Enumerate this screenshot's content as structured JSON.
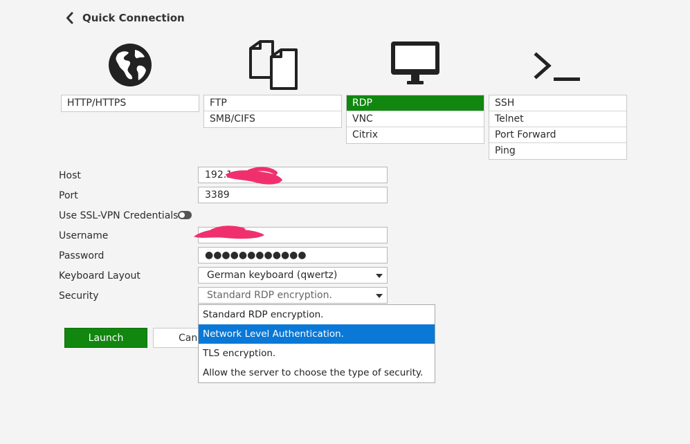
{
  "header": {
    "back_title": "Quick Connection"
  },
  "protocols": [
    {
      "icon": "globe-icon",
      "options": [
        {
          "label": "HTTP/HTTPS",
          "active": false
        }
      ]
    },
    {
      "icon": "copy-files-icon",
      "options": [
        {
          "label": "FTP",
          "active": false
        },
        {
          "label": "SMB/CIFS",
          "active": false
        }
      ]
    },
    {
      "icon": "monitor-icon",
      "options": [
        {
          "label": "RDP",
          "active": true
        },
        {
          "label": "VNC",
          "active": false
        },
        {
          "label": "Citrix",
          "active": false
        }
      ]
    },
    {
      "icon": "terminal-icon",
      "options": [
        {
          "label": "SSH",
          "active": false
        },
        {
          "label": "Telnet",
          "active": false
        },
        {
          "label": "Port Forward",
          "active": false
        },
        {
          "label": "Ping",
          "active": false
        }
      ]
    }
  ],
  "form": {
    "host_label": "Host",
    "host_value": "192.1",
    "port_label": "Port",
    "port_value": "3389",
    "ssl_label": "Use SSL-VPN Credentials",
    "ssl_enabled": false,
    "username_label": "Username",
    "username_value": "",
    "password_label": "Password",
    "password_value": "●●●●●●●●●●●●",
    "keyboard_label": "Keyboard Layout",
    "keyboard_value": "German keyboard (qwertz)",
    "security_label": "Security",
    "security_value": "Standard RDP encryption."
  },
  "security_options": [
    {
      "label": "Standard RDP encryption.",
      "highlighted": false
    },
    {
      "label": "Network Level Authentication.",
      "highlighted": true
    },
    {
      "label": "TLS encryption.",
      "highlighted": false
    },
    {
      "label": "Allow the server to choose the type of security.",
      "highlighted": false
    }
  ],
  "buttons": {
    "launch_label": "Launch",
    "cancel_label": "Cancel"
  },
  "colors": {
    "active_green": "#11870f",
    "highlight_blue": "#0a78d6",
    "redaction_pink": "#f0306e"
  }
}
